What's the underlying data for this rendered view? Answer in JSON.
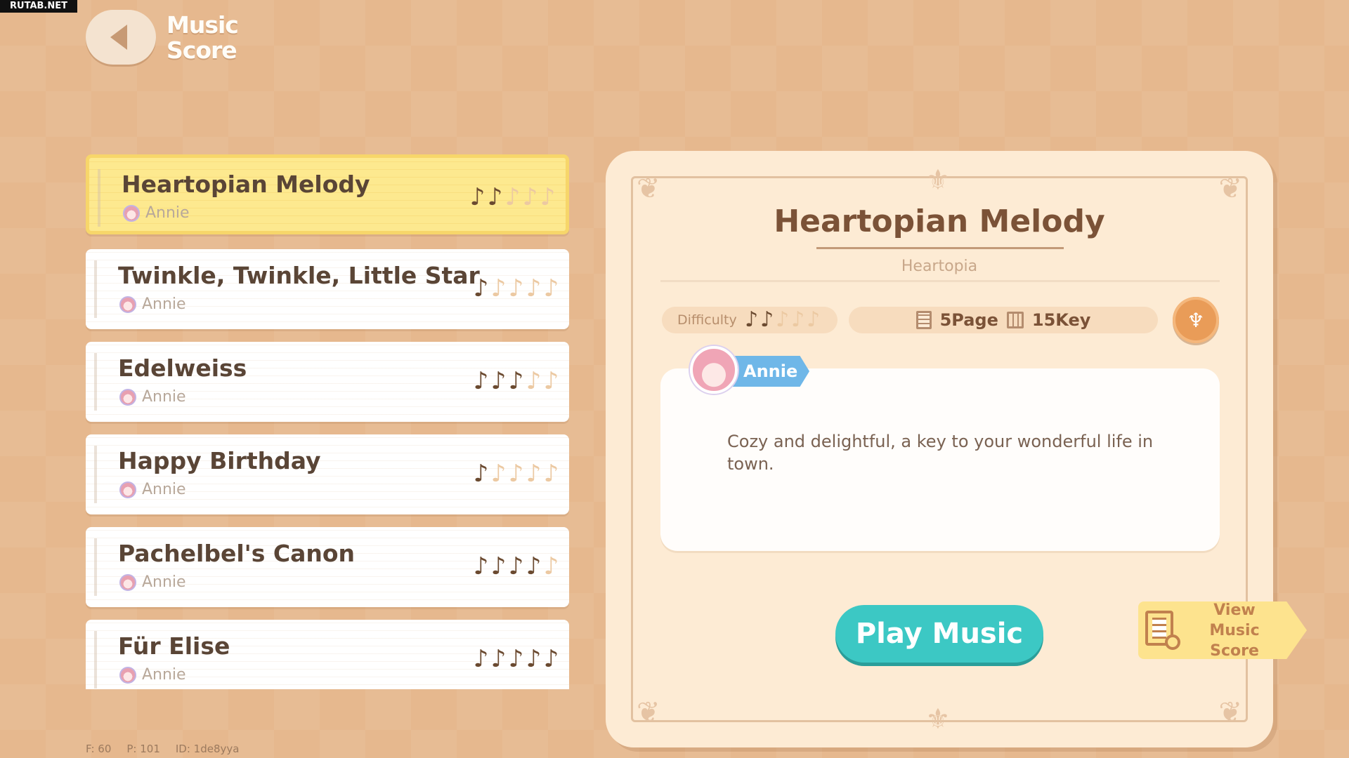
{
  "watermark": "RUTAB.NET",
  "header": {
    "title_line1": "Music",
    "title_line2": "Score"
  },
  "songs": [
    {
      "name": "Heartopian Melody",
      "composer": "Annie",
      "difficulty": 2,
      "max_difficulty": 5,
      "selected": true
    },
    {
      "name": "Twinkle, Twinkle, Little Star",
      "composer": "Annie",
      "difficulty": 1,
      "max_difficulty": 5,
      "selected": false
    },
    {
      "name": "Edelweiss",
      "composer": "Annie",
      "difficulty": 3,
      "max_difficulty": 5,
      "selected": false
    },
    {
      "name": "Happy Birthday",
      "composer": "Annie",
      "difficulty": 1,
      "max_difficulty": 5,
      "selected": false
    },
    {
      "name": "Pachelbel's Canon",
      "composer": "Annie",
      "difficulty": 4,
      "max_difficulty": 5,
      "selected": false
    },
    {
      "name": "Für Elise",
      "composer": "Annie",
      "difficulty": 5,
      "max_difficulty": 5,
      "selected": false
    }
  ],
  "detail": {
    "title": "Heartopian Melody",
    "subtitle": "Heartopia",
    "difficulty_label": "Difficulty",
    "difficulty": 2,
    "max_difficulty": 5,
    "pages": "5Page",
    "keys": "15Key",
    "author": "Annie",
    "description": "Cozy and delightful, a key to your wonderful life in town.",
    "play_button": "Play Music",
    "view_score_button": "View Music Score"
  },
  "debug": {
    "fps": "F: 60",
    "ping": "P: 101",
    "id": "ID: 1de8yya"
  },
  "colors": {
    "note_on": "#6b4a30",
    "note_off": "#ecc9a2",
    "selected_row": "#fde98f",
    "play_button": "#3cc8c4"
  },
  "icons": {
    "back": "back-arrow-icon",
    "note": "music-note-icon",
    "page": "page-icon",
    "key": "piano-key-icon",
    "lyre": "lyre-icon",
    "view_score": "sheet-search-icon"
  }
}
